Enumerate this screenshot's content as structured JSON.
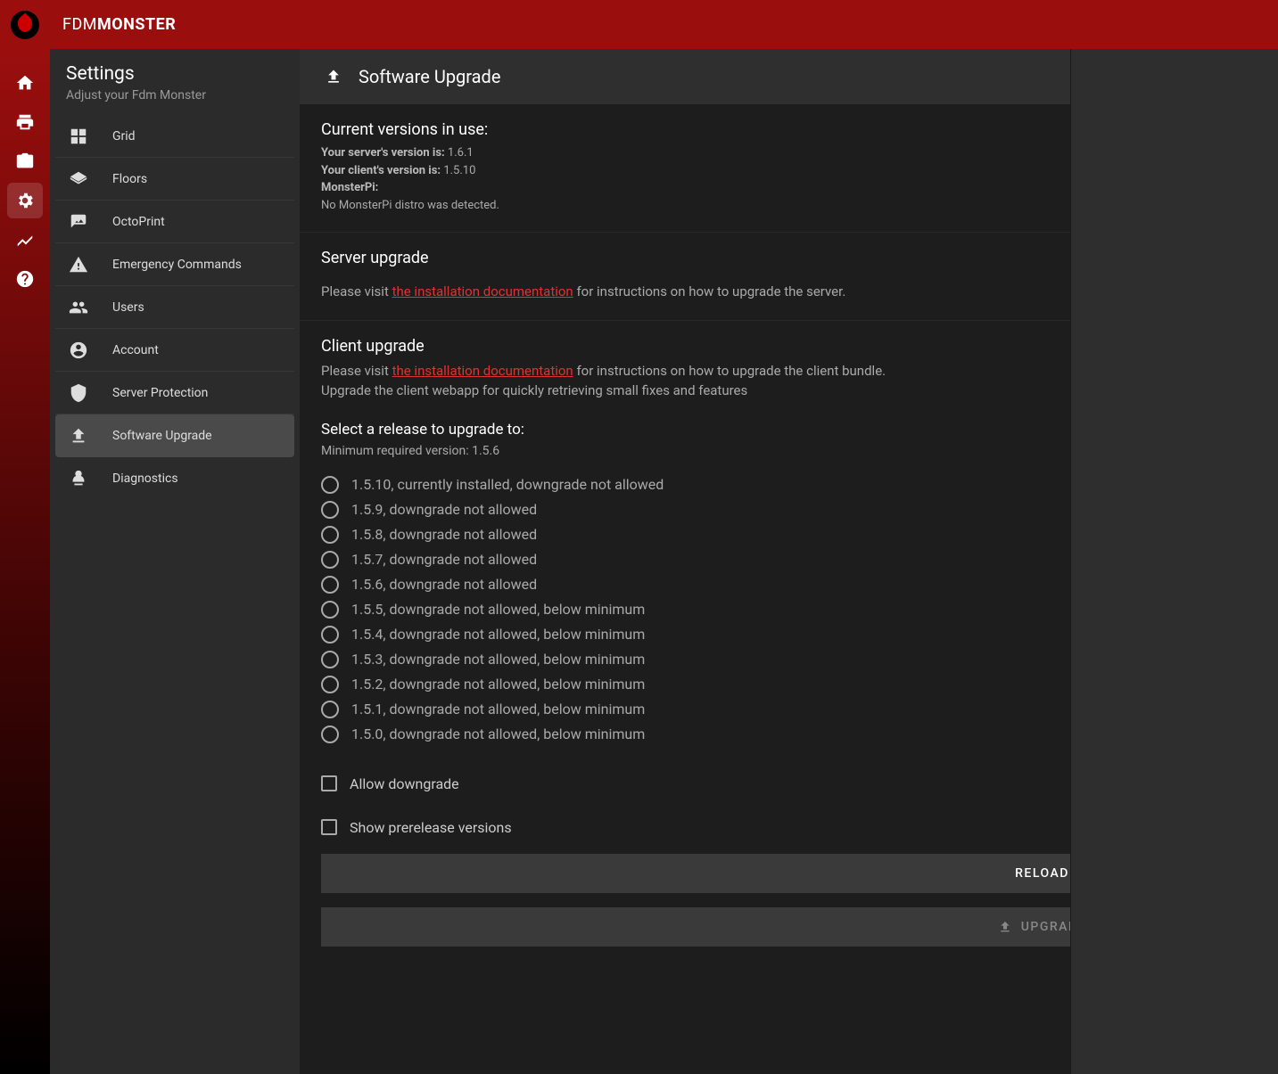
{
  "brand": {
    "light": "FDM",
    "bold": "MONSTER"
  },
  "rail": [
    {
      "key": "home",
      "active": false
    },
    {
      "key": "print",
      "active": false
    },
    {
      "key": "camera",
      "active": false
    },
    {
      "key": "settings",
      "active": true
    },
    {
      "key": "chart",
      "active": false
    },
    {
      "key": "help",
      "active": false
    }
  ],
  "sidebar": {
    "title": "Settings",
    "subtitle": "Adjust your Fdm Monster",
    "items": [
      {
        "key": "grid",
        "label": "Grid"
      },
      {
        "key": "floors",
        "label": "Floors"
      },
      {
        "key": "octoprint",
        "label": "OctoPrint"
      },
      {
        "key": "emergency",
        "label": "Emergency Commands"
      },
      {
        "key": "users",
        "label": "Users"
      },
      {
        "key": "account",
        "label": "Account"
      },
      {
        "key": "protection",
        "label": "Server Protection"
      },
      {
        "key": "upgrade",
        "label": "Software Upgrade",
        "active": true
      },
      {
        "key": "diagnostics",
        "label": "Diagnostics"
      }
    ]
  },
  "page": {
    "title": "Software Upgrade",
    "current": {
      "heading": "Current versions in use:",
      "server_label": "Your server's version is:",
      "server_value": "1.6.1",
      "client_label": "Your client's version is:",
      "client_value": "1.5.10",
      "monsterpi_label": "MonsterPi:",
      "monsterpi_value": "No MonsterPi distro was detected."
    },
    "server": {
      "heading": "Server upgrade",
      "pre": "Please visit ",
      "link": "the installation documentation",
      "post": " for instructions on how to upgrade the server."
    },
    "client": {
      "heading": "Client upgrade",
      "pre": "Please visit ",
      "link": "the installation documentation",
      "post": " for instructions on how to upgrade the client bundle.",
      "info": "Upgrade the client webapp for quickly retrieving small fixes and features",
      "select_label": "Select a release to upgrade to:",
      "min_label": "Minimum required version: ",
      "min_value": "1.5.6",
      "releases": [
        "1.5.10, currently installed, downgrade not allowed",
        "1.5.9, downgrade not allowed",
        "1.5.8, downgrade not allowed",
        "1.5.7, downgrade not allowed",
        "1.5.6, downgrade not allowed",
        "1.5.5, downgrade not allowed, below minimum",
        "1.5.4, downgrade not allowed, below minimum",
        "1.5.3, downgrade not allowed, below minimum",
        "1.5.2, downgrade not allowed, below minimum",
        "1.5.1, downgrade not allowed, below minimum",
        "1.5.0, downgrade not allowed, below minimum"
      ],
      "allow_downgrade": "Allow downgrade",
      "show_prerelease": "Show prerelease versions",
      "btn_reload": "RELOAD RELEASE VERSION LIST",
      "btn_upgrade": "UPGRADE/DOWNGRADE CLIENT"
    }
  }
}
